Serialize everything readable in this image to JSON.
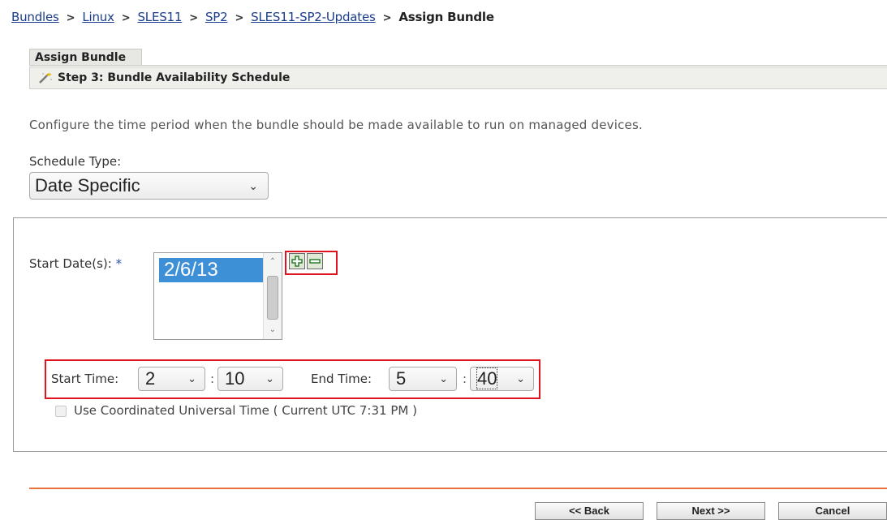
{
  "breadcrumb": {
    "items": [
      "Bundles",
      "Linux",
      "SLES11",
      "SP2",
      "SLES11-SP2-Updates"
    ],
    "separator": ">",
    "current": "Assign Bundle"
  },
  "tab": {
    "label": "Assign Bundle"
  },
  "step": {
    "title": "Step 3: Bundle Availability Schedule",
    "icon": "wand-icon"
  },
  "description": "Configure the time period when the bundle should be made available to run on managed devices.",
  "schedule_type": {
    "label": "Schedule Type:",
    "value": "Date Specific"
  },
  "start_dates": {
    "label": "Start Date(s):",
    "required_marker": "*",
    "items": [
      "2/6/13"
    ],
    "add_icon": "plus-icon",
    "remove_icon": "minus-icon"
  },
  "time": {
    "start_label": "Start Time:",
    "start_hour": "2",
    "start_minute": "10",
    "end_label": "End Time:",
    "end_hour": "5",
    "end_minute": "40",
    "separator": ":"
  },
  "utc": {
    "label": "Use Coordinated Universal Time ( Current UTC 7:31 PM )",
    "checked": false
  },
  "buttons": {
    "back": "<< Back",
    "next": "Next >>",
    "cancel": "Cancel"
  },
  "colors": {
    "link": "#1a3c8c",
    "selection": "#3d8fd6",
    "highlight_box": "#e0141f",
    "divider": "#e8733a"
  }
}
